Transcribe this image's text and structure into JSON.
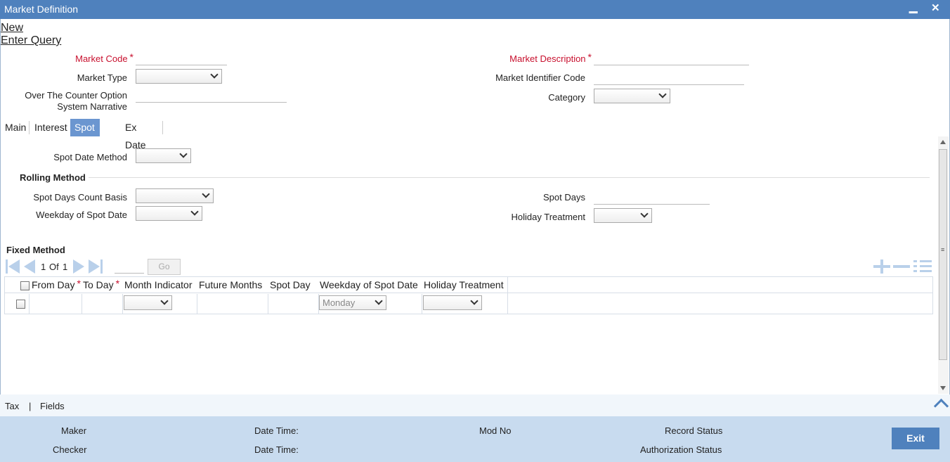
{
  "window": {
    "title": "Market Definition",
    "minimize_glyph": "▁",
    "close_glyph": "✕"
  },
  "actions": {
    "new": "New",
    "enter_query": "Enter Query"
  },
  "header_form": {
    "market_code_label": "Market Code",
    "market_description_label": "Market Description",
    "market_type_label": "Market Type",
    "market_identifier_code_label": "Market Identifier Code",
    "otc_label_line1": "Over The Counter Option",
    "otc_label_line2": "System Narrative",
    "category_label": "Category",
    "required_mark": "*"
  },
  "tabs": [
    {
      "label": "Main"
    },
    {
      "label": "Interest"
    },
    {
      "label": "Spot Date"
    },
    {
      "label": "Ex Date"
    }
  ],
  "active_tab": "Spot Date",
  "spot_date": {
    "spot_date_method_label": "Spot Date Method",
    "rolling_method_title": "Rolling Method",
    "spot_days_count_basis_label": "Spot Days Count Basis",
    "weekday_of_spot_date_label": "Weekday of Spot Date",
    "spot_days_label": "Spot Days",
    "holiday_treatment_label": "Holiday Treatment",
    "fixed_method_title": "Fixed Method"
  },
  "pager": {
    "current": "1",
    "of_label": "Of",
    "total": "1",
    "go_label": "Go"
  },
  "fixed_grid": {
    "columns": [
      {
        "label": "From Day",
        "required": true
      },
      {
        "label": "To Day",
        "required": true
      },
      {
        "label": "Month Indicator",
        "required": false
      },
      {
        "label": "Future Months",
        "required": false
      },
      {
        "label": "Spot Day",
        "required": false
      },
      {
        "label": "Weekday of Spot Date",
        "required": false
      },
      {
        "label": "Holiday Treatment",
        "required": false
      }
    ],
    "row": {
      "weekday_value": "Monday"
    }
  },
  "bottom_links": {
    "tax": "Tax",
    "separator": "|",
    "fields": "Fields"
  },
  "footer": {
    "maker": "Maker",
    "checker": "Checker",
    "date_time_1": "Date Time:",
    "date_time_2": "Date Time:",
    "mod_no": "Mod No",
    "record_status": "Record Status",
    "authorization_status": "Authorization Status",
    "exit": "Exit"
  },
  "colors": {
    "titlebar": "#4f81bd",
    "active_tab": "#6b96d0",
    "footer": "#c8dbef",
    "required": "#c8102e"
  }
}
